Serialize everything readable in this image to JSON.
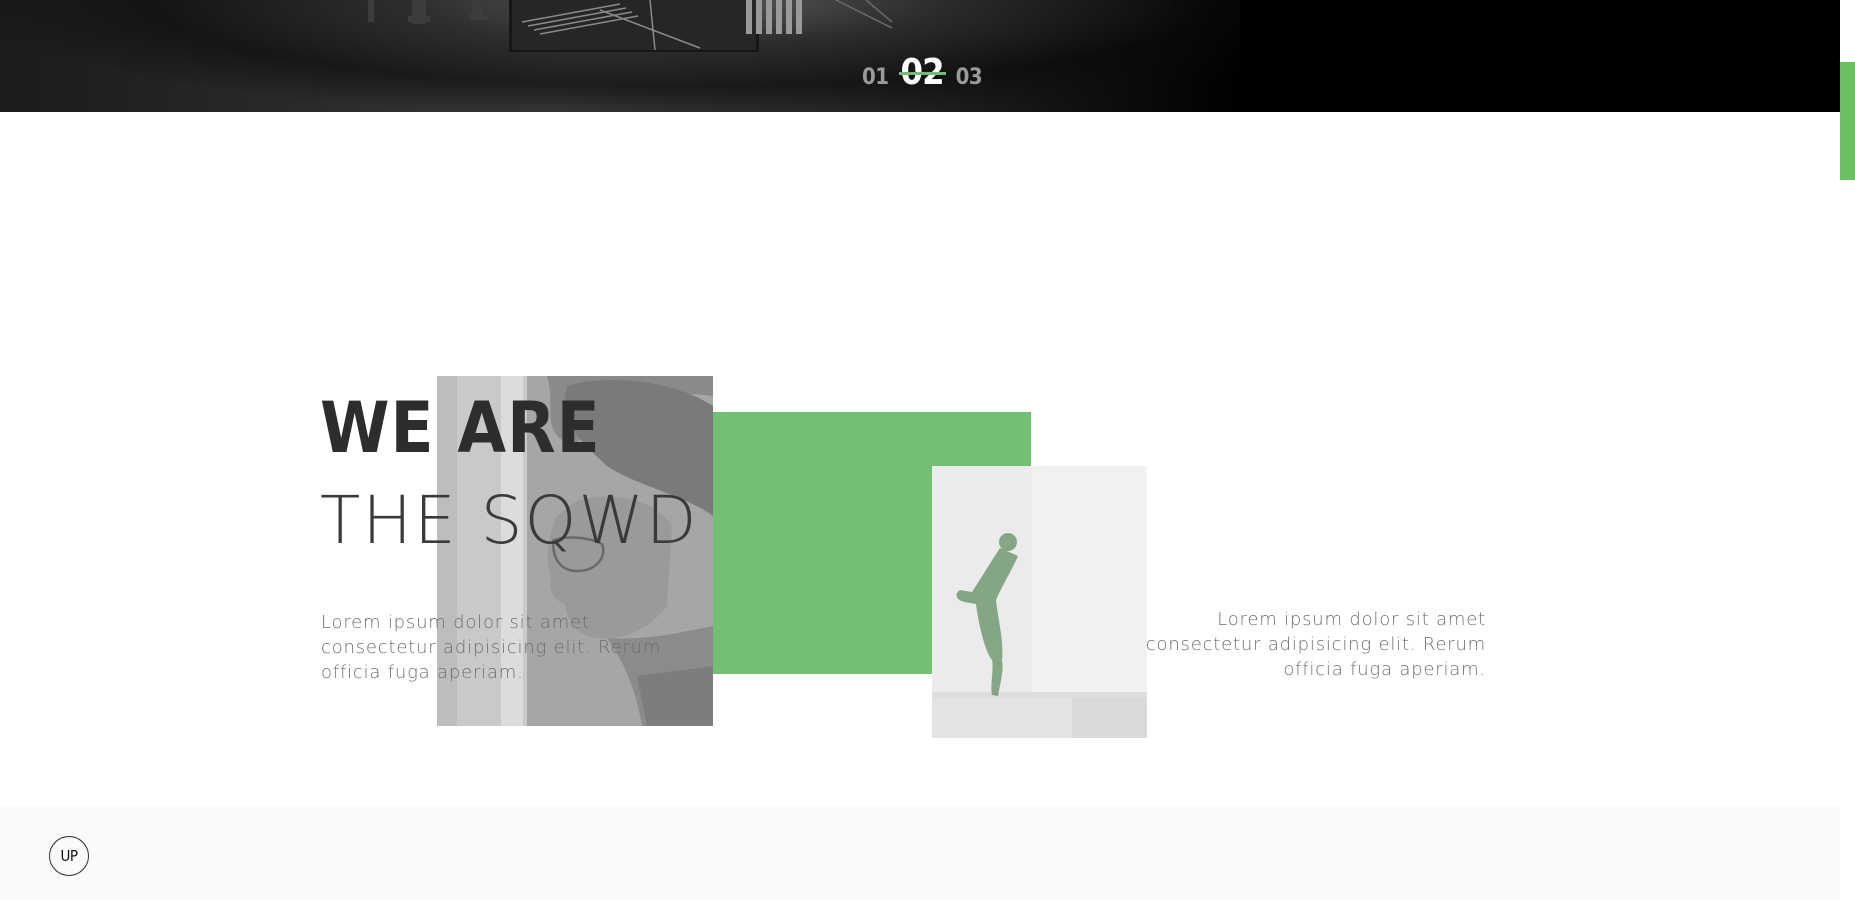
{
  "hero": {
    "slides": [
      "01",
      "02",
      "03"
    ],
    "active_slide": "02"
  },
  "about": {
    "headline_line1": "WE ARE",
    "headline_line2": "THE SQWD",
    "paragraph_left": "Lorem ipsum dolor sit amet\nconsectetur adipisicing elit. Rerum\nofficia fuga aperiam.",
    "paragraph_right": "Lorem ipsum dolor sit amet\nconsectetur adipisicing elit. Rerum\nofficia fuga aperiam."
  },
  "footer": {
    "up_label": "UP"
  },
  "colors": {
    "accent_green": "#72bf73",
    "scroll_thumb": "#6cbf62",
    "hero_bg": "#000000",
    "headline": "#2f2f2f",
    "body_text": "#6e6e6e",
    "footer_bg": "#fafafa"
  },
  "icons": {
    "up": "up-arrow-circle-icon"
  }
}
